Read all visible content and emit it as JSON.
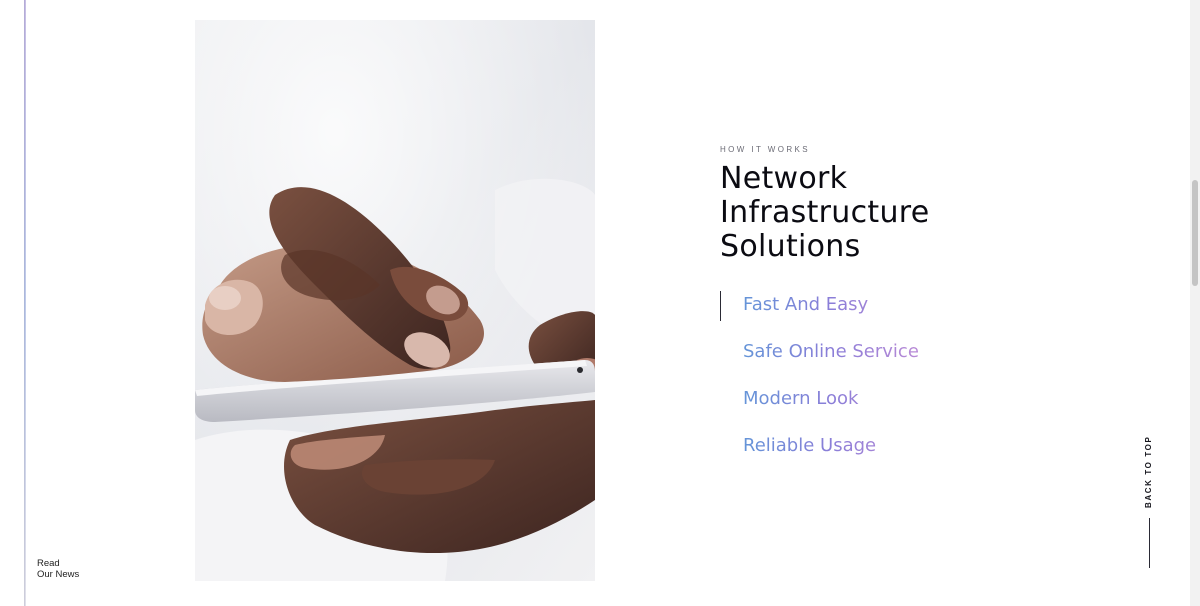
{
  "sidebar": {
    "news_link_line1": "Read",
    "news_link_line2": "Our News"
  },
  "hero_image": {
    "alt": "Hands using a smartphone"
  },
  "section": {
    "eyebrow": "HOW IT WORKS",
    "title_line1": "Network",
    "title_line2": "Infrastructure",
    "title_line3": "Solutions"
  },
  "features": [
    {
      "label": "Fast And Easy",
      "active": true
    },
    {
      "label": "Safe Online Service",
      "active": false
    },
    {
      "label": "Modern Look",
      "active": false
    },
    {
      "label": "Reliable Usage",
      "active": false
    }
  ],
  "back_to_top": {
    "label": "BACK TO TOP"
  },
  "colors": {
    "gradient_start": "#5b9bd8",
    "gradient_mid": "#8a7ed8",
    "gradient_end": "#b98ad6",
    "title": "#0b0b12"
  }
}
